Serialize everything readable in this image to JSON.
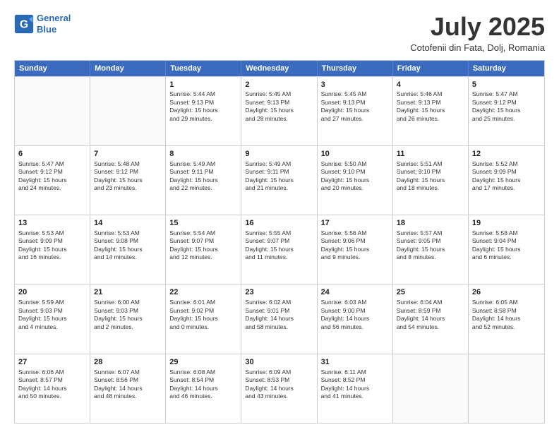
{
  "header": {
    "logo_line1": "General",
    "logo_line2": "Blue",
    "month_title": "July 2025",
    "location": "Cotofenii din Fata, Dolj, Romania"
  },
  "days_of_week": [
    "Sunday",
    "Monday",
    "Tuesday",
    "Wednesday",
    "Thursday",
    "Friday",
    "Saturday"
  ],
  "weeks": [
    [
      {
        "day": "",
        "info": ""
      },
      {
        "day": "",
        "info": ""
      },
      {
        "day": "1",
        "info": "Sunrise: 5:44 AM\nSunset: 9:13 PM\nDaylight: 15 hours\nand 29 minutes."
      },
      {
        "day": "2",
        "info": "Sunrise: 5:45 AM\nSunset: 9:13 PM\nDaylight: 15 hours\nand 28 minutes."
      },
      {
        "day": "3",
        "info": "Sunrise: 5:45 AM\nSunset: 9:13 PM\nDaylight: 15 hours\nand 27 minutes."
      },
      {
        "day": "4",
        "info": "Sunrise: 5:46 AM\nSunset: 9:13 PM\nDaylight: 15 hours\nand 26 minutes."
      },
      {
        "day": "5",
        "info": "Sunrise: 5:47 AM\nSunset: 9:12 PM\nDaylight: 15 hours\nand 25 minutes."
      }
    ],
    [
      {
        "day": "6",
        "info": "Sunrise: 5:47 AM\nSunset: 9:12 PM\nDaylight: 15 hours\nand 24 minutes."
      },
      {
        "day": "7",
        "info": "Sunrise: 5:48 AM\nSunset: 9:12 PM\nDaylight: 15 hours\nand 23 minutes."
      },
      {
        "day": "8",
        "info": "Sunrise: 5:49 AM\nSunset: 9:11 PM\nDaylight: 15 hours\nand 22 minutes."
      },
      {
        "day": "9",
        "info": "Sunrise: 5:49 AM\nSunset: 9:11 PM\nDaylight: 15 hours\nand 21 minutes."
      },
      {
        "day": "10",
        "info": "Sunrise: 5:50 AM\nSunset: 9:10 PM\nDaylight: 15 hours\nand 20 minutes."
      },
      {
        "day": "11",
        "info": "Sunrise: 5:51 AM\nSunset: 9:10 PM\nDaylight: 15 hours\nand 18 minutes."
      },
      {
        "day": "12",
        "info": "Sunrise: 5:52 AM\nSunset: 9:09 PM\nDaylight: 15 hours\nand 17 minutes."
      }
    ],
    [
      {
        "day": "13",
        "info": "Sunrise: 5:53 AM\nSunset: 9:09 PM\nDaylight: 15 hours\nand 16 minutes."
      },
      {
        "day": "14",
        "info": "Sunrise: 5:53 AM\nSunset: 9:08 PM\nDaylight: 15 hours\nand 14 minutes."
      },
      {
        "day": "15",
        "info": "Sunrise: 5:54 AM\nSunset: 9:07 PM\nDaylight: 15 hours\nand 12 minutes."
      },
      {
        "day": "16",
        "info": "Sunrise: 5:55 AM\nSunset: 9:07 PM\nDaylight: 15 hours\nand 11 minutes."
      },
      {
        "day": "17",
        "info": "Sunrise: 5:56 AM\nSunset: 9:06 PM\nDaylight: 15 hours\nand 9 minutes."
      },
      {
        "day": "18",
        "info": "Sunrise: 5:57 AM\nSunset: 9:05 PM\nDaylight: 15 hours\nand 8 minutes."
      },
      {
        "day": "19",
        "info": "Sunrise: 5:58 AM\nSunset: 9:04 PM\nDaylight: 15 hours\nand 6 minutes."
      }
    ],
    [
      {
        "day": "20",
        "info": "Sunrise: 5:59 AM\nSunset: 9:03 PM\nDaylight: 15 hours\nand 4 minutes."
      },
      {
        "day": "21",
        "info": "Sunrise: 6:00 AM\nSunset: 9:03 PM\nDaylight: 15 hours\nand 2 minutes."
      },
      {
        "day": "22",
        "info": "Sunrise: 6:01 AM\nSunset: 9:02 PM\nDaylight: 15 hours\nand 0 minutes."
      },
      {
        "day": "23",
        "info": "Sunrise: 6:02 AM\nSunset: 9:01 PM\nDaylight: 14 hours\nand 58 minutes."
      },
      {
        "day": "24",
        "info": "Sunrise: 6:03 AM\nSunset: 9:00 PM\nDaylight: 14 hours\nand 56 minutes."
      },
      {
        "day": "25",
        "info": "Sunrise: 6:04 AM\nSunset: 8:59 PM\nDaylight: 14 hours\nand 54 minutes."
      },
      {
        "day": "26",
        "info": "Sunrise: 6:05 AM\nSunset: 8:58 PM\nDaylight: 14 hours\nand 52 minutes."
      }
    ],
    [
      {
        "day": "27",
        "info": "Sunrise: 6:06 AM\nSunset: 8:57 PM\nDaylight: 14 hours\nand 50 minutes."
      },
      {
        "day": "28",
        "info": "Sunrise: 6:07 AM\nSunset: 8:56 PM\nDaylight: 14 hours\nand 48 minutes."
      },
      {
        "day": "29",
        "info": "Sunrise: 6:08 AM\nSunset: 8:54 PM\nDaylight: 14 hours\nand 46 minutes."
      },
      {
        "day": "30",
        "info": "Sunrise: 6:09 AM\nSunset: 8:53 PM\nDaylight: 14 hours\nand 43 minutes."
      },
      {
        "day": "31",
        "info": "Sunrise: 6:11 AM\nSunset: 8:52 PM\nDaylight: 14 hours\nand 41 minutes."
      },
      {
        "day": "",
        "info": ""
      },
      {
        "day": "",
        "info": ""
      }
    ]
  ]
}
